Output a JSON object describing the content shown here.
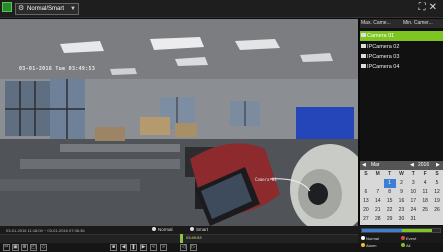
{
  "topbar": {
    "mode_label": "Normal/Smart",
    "icons": [
      "settings-icon",
      "fullscreen-icon",
      "close-icon"
    ]
  },
  "video": {
    "osd_datetime": "03-01-2016 Tue 03:49:53",
    "osd_camera": "Camera 01"
  },
  "camera_list": {
    "headers": [
      "Max. Came...",
      "Min. Camer..."
    ],
    "items": [
      {
        "label": "Camera 01",
        "selected": true
      },
      {
        "label": "IPCamera 02",
        "selected": false
      },
      {
        "label": "IPCamera 03",
        "selected": false
      },
      {
        "label": "IPCamera 04",
        "selected": false
      }
    ]
  },
  "calendar": {
    "month": "Mar",
    "year": "2016",
    "weekdays": [
      "S",
      "M",
      "T",
      "W",
      "T",
      "F",
      "S"
    ],
    "days": [
      [
        "",
        "",
        "1",
        "2",
        "3",
        "4",
        "5"
      ],
      [
        "6",
        "7",
        "8",
        "9",
        "10",
        "11",
        "12"
      ],
      [
        "13",
        "14",
        "15",
        "16",
        "17",
        "18",
        "19"
      ],
      [
        "20",
        "21",
        "22",
        "23",
        "24",
        "25",
        "26"
      ],
      [
        "27",
        "28",
        "29",
        "30",
        "31",
        "",
        ""
      ]
    ],
    "selected_day": "1"
  },
  "timeline": {
    "range_text": "03-01-2016 11:18:00 ~ 03-01-2016 07:36:36",
    "legend_normal": "Normal",
    "legend_smart": "Smart",
    "cursor_time": "03:49:53"
  },
  "record_legend": {
    "items": [
      "Normal",
      "Event",
      "Alarm",
      "All"
    ]
  },
  "colors": {
    "accent_green": "#7ec422",
    "calendar_today": "#3a7fd5"
  }
}
